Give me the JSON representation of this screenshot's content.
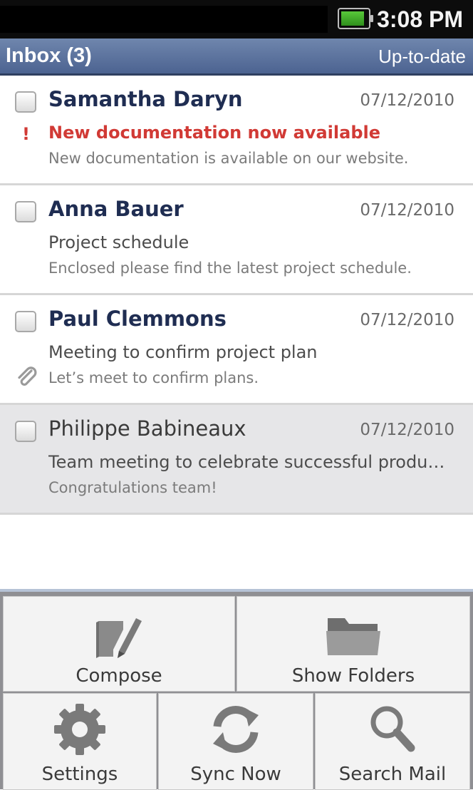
{
  "status_bar": {
    "time": "3:08 PM",
    "battery_level": 0.9,
    "battery_color": "#3fa82a"
  },
  "header": {
    "title": "Inbox (3)",
    "sync_status": "Up-to-date"
  },
  "messages": [
    {
      "sender": "Samantha Daryn",
      "date": "07/12/2010",
      "subject": "New documentation now available",
      "preview": "New documentation is available on our website.",
      "priority_mark": "!"
    },
    {
      "sender": "Anna Bauer",
      "date": "07/12/2010",
      "subject": "Project schedule",
      "preview": "Enclosed please find the latest project schedule."
    },
    {
      "sender": "Paul Clemmons",
      "date": "07/12/2010",
      "subject": "Meeting to confirm project plan",
      "preview": "Let’s meet to confirm plans.",
      "attachment_icon": "paperclip-icon"
    },
    {
      "sender": "Philippe Babineaux",
      "date": "07/12/2010",
      "subject": "Team meeting to celebrate successful produ…",
      "preview": "Congratulations team!"
    }
  ],
  "menu": {
    "compose": {
      "label": "Compose",
      "icon": "compose-icon"
    },
    "show_folders": {
      "label": "Show Folders",
      "icon": "folder-icon"
    },
    "settings": {
      "label": "Settings",
      "icon": "gear-icon"
    },
    "sync_now": {
      "label": "Sync Now",
      "icon": "sync-icon"
    },
    "search_mail": {
      "label": "Search Mail",
      "icon": "search-icon"
    }
  }
}
